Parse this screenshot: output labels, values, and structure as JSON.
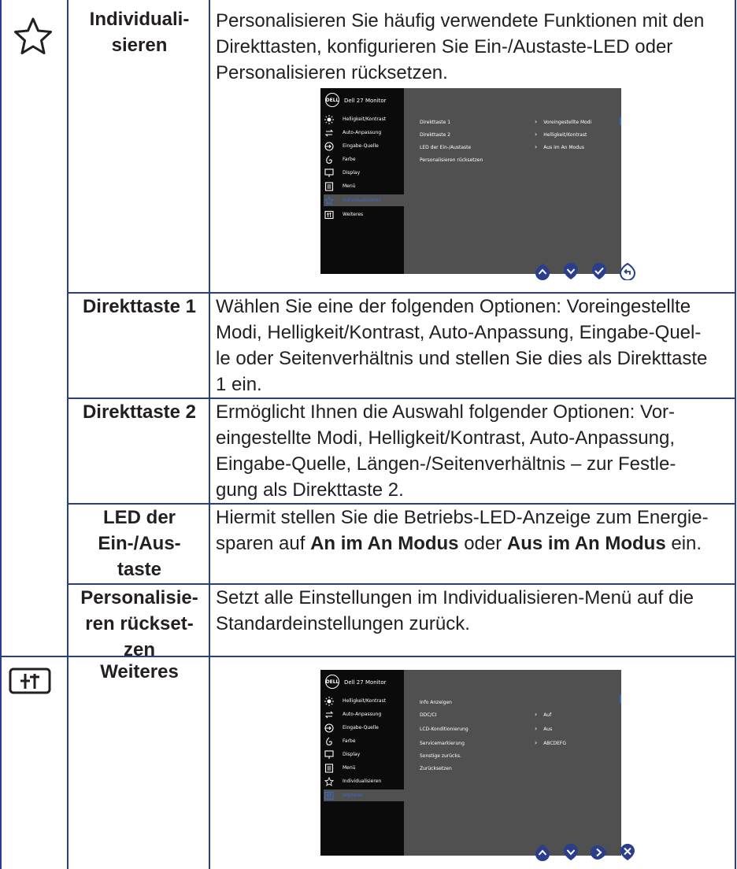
{
  "rows": {
    "individualisieren": {
      "name_line1": "Individuali-",
      "name_line2": "sieren",
      "icon": "star-icon",
      "desc_lines": [
        "Personalisieren Sie häufig verwendete Funktionen mit den",
        "Direkttasten, konfigurieren Sie Ein-/Austaste-LED oder",
        "Personalisieren rücksetzen."
      ]
    },
    "direkttaste1": {
      "name": "Direkttaste 1",
      "desc_lines": [
        "Wählen Sie eine der folgenden Optionen: Voreingestellte",
        "Modi, Helligkeit/Kontrast, Auto-Anpassung, Eingabe-Quel-",
        "le oder Seitenverhältnis und stellen Sie dies als Direkttaste",
        "1 ein."
      ]
    },
    "direkttaste2": {
      "name": "Direkttaste 2",
      "desc_lines": [
        "Ermöglicht Ihnen die Auswahl folgender Optionen: Vor-",
        "eingestellte Modi, Helligkeit/Kontrast, Auto-Anpassung,",
        "Eingabe-Quelle, Längen-/Seitenverhältnis – zur Festle-",
        "gung als Direkttaste 2."
      ]
    },
    "led": {
      "name_line1": "LED der",
      "name_line2": "Ein-/Aus-",
      "name_line3": "taste",
      "desc_line1": "Hiermit stellen Sie die Betriebs-LED-Anzeige zum Energie-",
      "desc_pre": "sparen auf ",
      "desc_bold1": "An im An Modus",
      "desc_mid": " oder ",
      "desc_bold2": "Aus im An Modus",
      "desc_post": " ein."
    },
    "reset": {
      "name_line1": "Personalisie-",
      "name_line2": "ren rückset-",
      "name_line3": "zen",
      "desc_lines": [
        "Setzt alle Einstellungen im Individualisieren-Menü auf die",
        "Standardeinstellungen zurück."
      ]
    },
    "weiteres": {
      "name": "Weiteres",
      "icon": "others-icon"
    }
  },
  "osd1": {
    "logo": "DELL",
    "title": "Dell 27 Monitor",
    "menu": [
      "Helligkeit/Kontrast",
      "Auto-Anpassung",
      "Eingabe-Quelle",
      "Farbe",
      "Display",
      "Menü",
      "Individualisieren",
      "Weiteres"
    ],
    "selected": "Individualisieren",
    "rows": [
      "Direkttaste 1",
      "Direkttaste 2",
      "LED der Ein-/Austaste",
      "Personalisieren rücksetzen"
    ],
    "values": [
      "Voreingestellte Modi",
      "Helligkeit/Kontrast",
      "Aus im An Modus"
    ]
  },
  "osd2": {
    "logo": "DELL",
    "title": "Dell 27 Monitor",
    "menu": [
      "Helligkeit/Kontrast",
      "Auto-Anpassung",
      "Eingabe-Quelle",
      "Farbe",
      "Display",
      "Menü",
      "Individualisieren",
      "Weiteres"
    ],
    "selected": "Weiteres",
    "rows": [
      "Info Anzeigen",
      "DDC/CI",
      "LCD-Konditionierung",
      "Servicemarkierung",
      "Sonstige zurücks.",
      "Zurücksetzen"
    ],
    "values": [
      "Auf",
      "Aus",
      "ABCDEFG"
    ]
  },
  "buttons1": [
    "up-button-icon",
    "down-button-icon",
    "check-button-icon",
    "back-button-icon"
  ],
  "buttons2": [
    "up-button-icon",
    "down-button-icon",
    "right-button-icon",
    "close-button-icon"
  ],
  "colors": {
    "border": "#2b3e8c",
    "osd_side": "#0b0b0b",
    "osd_main": "#505050",
    "accent": "#3a6bc6",
    "button": "#2b3e8c"
  }
}
